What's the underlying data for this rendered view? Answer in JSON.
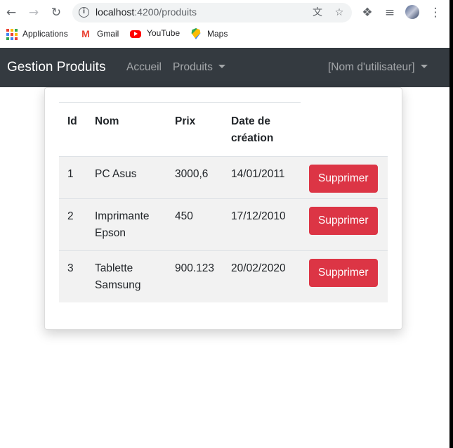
{
  "browser": {
    "url_host": "localhost",
    "url_path": ":4200/produits",
    "bookmarks": [
      {
        "label": "Applications",
        "icon": "apps-grid-icon"
      },
      {
        "label": "Gmail",
        "icon": "gmail-icon"
      },
      {
        "label": "YouTube",
        "icon": "youtube-icon"
      },
      {
        "label": "Maps",
        "icon": "maps-icon"
      }
    ]
  },
  "navbar": {
    "brand": "Gestion Produits",
    "links": [
      {
        "label": "Accueil"
      },
      {
        "label": "Produits"
      }
    ],
    "user_menu": "[Nom d'utilisateur]"
  },
  "table": {
    "headers": {
      "id": "Id",
      "nom": "Nom",
      "prix": "Prix",
      "date_line1": "Date de",
      "date_line2": "création"
    },
    "rows": [
      {
        "id": "1",
        "nom": "PC Asus",
        "prix": "3000,6",
        "date": "14/01/2011",
        "action": "Supprimer"
      },
      {
        "id": "2",
        "nom": "Imprimante Epson",
        "prix": "450",
        "date": "17/12/2010",
        "action": "Supprimer"
      },
      {
        "id": "3",
        "nom": "Tablette Samsung",
        "prix": "900.123",
        "date": "20/02/2020",
        "action": "Supprimer"
      }
    ]
  },
  "colors": {
    "navbar_bg": "#343a40",
    "danger": "#dc3545",
    "row_bg": "#f2f2f2"
  }
}
